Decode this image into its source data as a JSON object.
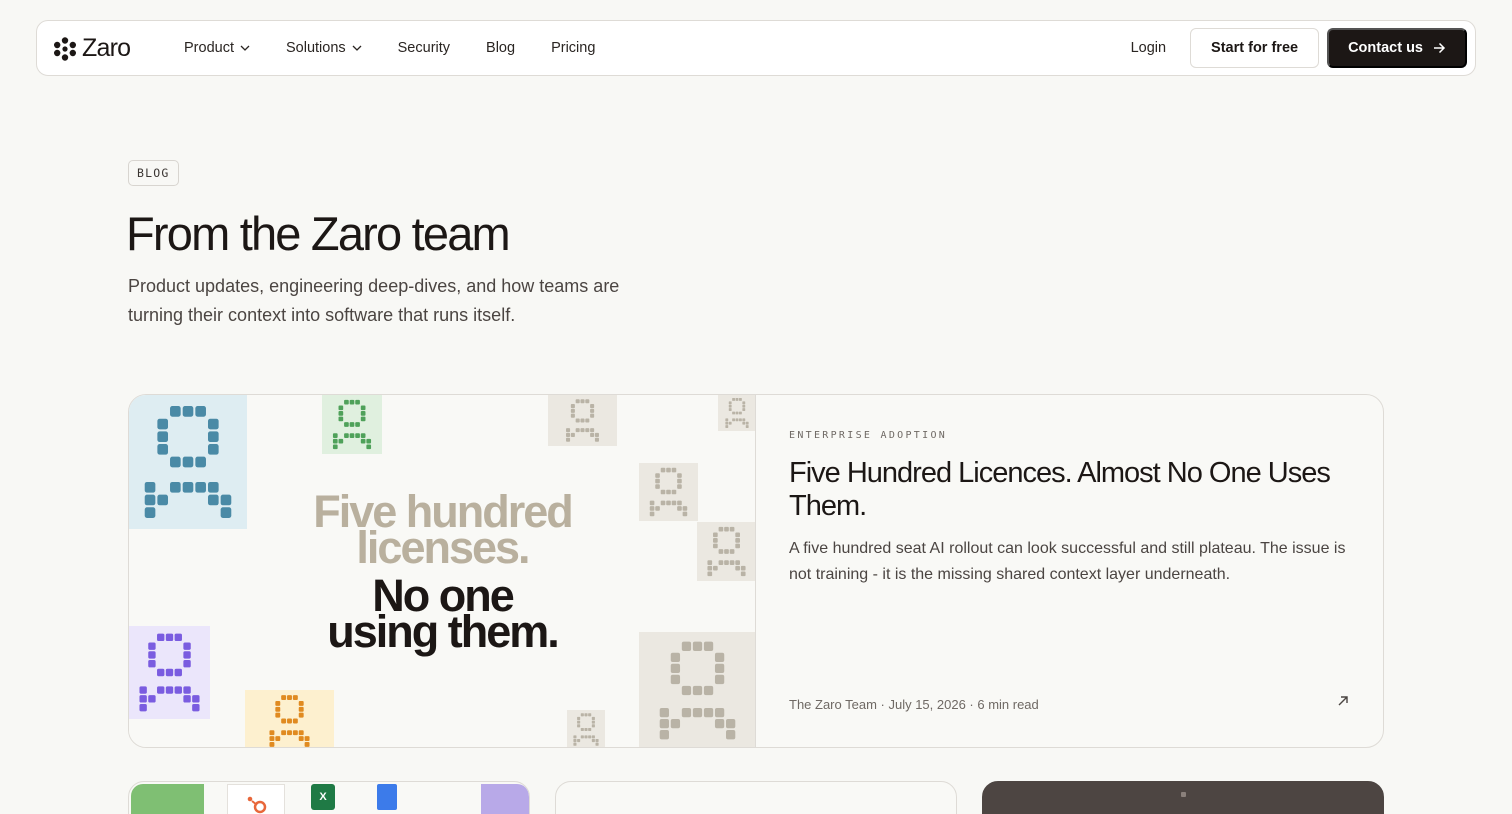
{
  "nav": {
    "brand": "Zaro",
    "links": [
      {
        "label": "Product",
        "dropdown": true
      },
      {
        "label": "Solutions",
        "dropdown": true
      },
      {
        "label": "Security",
        "dropdown": false
      },
      {
        "label": "Blog",
        "dropdown": false
      },
      {
        "label": "Pricing",
        "dropdown": false
      }
    ],
    "login": "Login",
    "start_free": "Start for free",
    "contact": "Contact us"
  },
  "hero": {
    "badge": "BLOG",
    "title": "From the Zaro team",
    "subtitle": "Product updates, engineering deep-dives, and how teams are turning their context into software that runs itself."
  },
  "featured": {
    "image_text": {
      "line1": "Five hundred",
      "line2": "licenses.",
      "line3": "No one",
      "line4": "using them."
    },
    "category": "ENTERPRISE ADOPTION",
    "title": "Five Hundred Licences. Almost No One Uses Them.",
    "excerpt": "A five hundred seat AI rollout can look successful and still plateau. The issue is not training - it is the missing shared context layer underneath.",
    "meta": "The Zaro Team · July 15, 2026 · 6 min read"
  },
  "colors": {
    "accent_dark": "#1c1715",
    "tile_blue": "#4a8aa6",
    "tile_green": "#4fa15a",
    "tile_purple": "#7a5ce0",
    "tile_orange": "#e08a20",
    "tile_beige": "#b9b3a6"
  }
}
